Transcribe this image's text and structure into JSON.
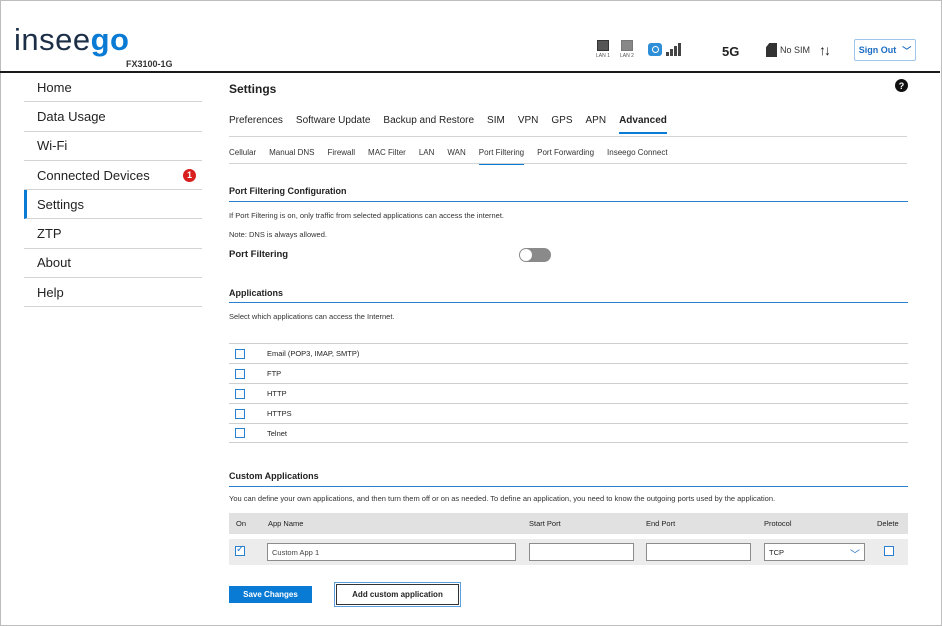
{
  "header": {
    "logo_left": "insee",
    "logo_right": "go",
    "model": "FX3100-1G",
    "lan1_label": "LAN 1",
    "lan2_label": "LAN 2",
    "network": "5G",
    "sim_status": "No SIM",
    "data_arrows": "↑↓",
    "sign_out_label": "Sign Out"
  },
  "sidebar": {
    "items": [
      {
        "label": "Home"
      },
      {
        "label": "Data Usage"
      },
      {
        "label": "Wi-Fi"
      },
      {
        "label": "Connected Devices",
        "badge": "1"
      },
      {
        "label": "Settings"
      },
      {
        "label": "ZTP"
      },
      {
        "label": "About"
      },
      {
        "label": "Help"
      }
    ],
    "active": "Settings"
  },
  "main": {
    "title": "Settings",
    "help_glyph": "?",
    "tabs": [
      "Preferences",
      "Software Update",
      "Backup and Restore",
      "SIM",
      "VPN",
      "GPS",
      "APN",
      "Advanced"
    ],
    "active_tab": "Advanced",
    "subtabs": [
      "Cellular",
      "Manual DNS",
      "Firewall",
      "MAC Filter",
      "LAN",
      "WAN",
      "Port Filtering",
      "Port Forwarding",
      "Inseego Connect"
    ],
    "active_subtab": "Port Filtering"
  },
  "config": {
    "title": "Port Filtering Configuration",
    "note1": "If Port Filtering is on, only traffic from selected applications can access the internet.",
    "note2": "Note: DNS is always allowed.",
    "toggle_label": "Port Filtering",
    "toggle_on": false
  },
  "applications": {
    "title": "Applications",
    "description": "Select which applications can access the Internet.",
    "items": [
      {
        "name": "Email (POP3, IMAP, SMTP)",
        "checked": false
      },
      {
        "name": "FTP",
        "checked": false
      },
      {
        "name": "HTTP",
        "checked": false
      },
      {
        "name": "HTTPS",
        "checked": false
      },
      {
        "name": "Telnet",
        "checked": false
      }
    ]
  },
  "custom": {
    "title": "Custom Applications",
    "description": "You can define your own applications, and then turn them off or on as needed. To define an application, you need to know the outgoing ports used by the application.",
    "columns": {
      "on": "On",
      "app_name": "App Name",
      "start_port": "Start Port",
      "end_port": "End Port",
      "protocol": "Protocol",
      "delete": "Delete"
    },
    "row": {
      "on": true,
      "app_name": "Custom App 1",
      "start_port": "",
      "end_port": "",
      "protocol": "TCP",
      "delete": false
    }
  },
  "actions": {
    "save": "Save Changes",
    "add": "Add custom application"
  },
  "colors": {
    "accent": "#0a7bd4",
    "badge": "#d81e1e"
  }
}
